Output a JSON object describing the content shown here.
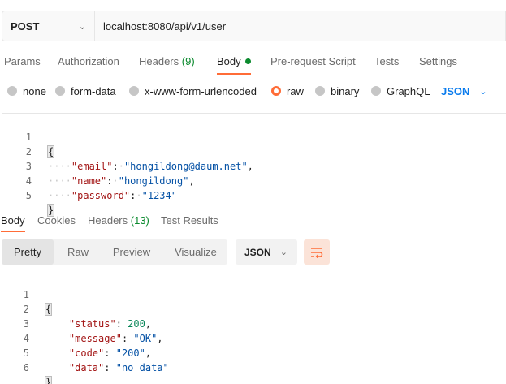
{
  "request": {
    "method": "POST",
    "url": "localhost:8080/api/v1/user"
  },
  "request_tabs": [
    {
      "label": "Params"
    },
    {
      "label": "Authorization"
    },
    {
      "label": "Headers",
      "count": "(9)"
    },
    {
      "label": "Body",
      "active": true
    },
    {
      "label": "Pre-request Script"
    },
    {
      "label": "Tests"
    },
    {
      "label": "Settings"
    }
  ],
  "body_types": [
    {
      "label": "none"
    },
    {
      "label": "form-data"
    },
    {
      "label": "x-www-form-urlencoded"
    },
    {
      "label": "raw",
      "selected": true
    },
    {
      "label": "binary"
    },
    {
      "label": "GraphQL"
    }
  ],
  "body_language": "JSON",
  "request_body": {
    "line_numbers": [
      "1",
      "2",
      "3",
      "4",
      "5"
    ],
    "open_brace": "{",
    "close_brace": "}",
    "fields": [
      {
        "key": "\"email\"",
        "value": "\"hongildong@daum.net\"",
        "suffix": ","
      },
      {
        "key": "\"name\"",
        "value": "\"hongildong\"",
        "suffix": ","
      },
      {
        "key": "\"password\"",
        "value": "\"1234\"",
        "suffix": ""
      }
    ]
  },
  "response_tabs": [
    {
      "label": "Body",
      "active": true
    },
    {
      "label": "Cookies"
    },
    {
      "label": "Headers",
      "count": "(13)"
    },
    {
      "label": "Test Results"
    }
  ],
  "view_modes": [
    {
      "label": "Pretty",
      "active": true
    },
    {
      "label": "Raw"
    },
    {
      "label": "Preview"
    },
    {
      "label": "Visualize"
    }
  ],
  "response_format": "JSON",
  "response_body": {
    "line_numbers": [
      "1",
      "2",
      "3",
      "4",
      "5",
      "6"
    ],
    "open_brace": "{",
    "close_brace": "}",
    "fields": [
      {
        "key": "\"status\"",
        "value": "200",
        "suffix": ","
      },
      {
        "key": "\"message\"",
        "value": "\"OK\"",
        "suffix": ","
      },
      {
        "key": "\"code\"",
        "value": "\"200\"",
        "suffix": ","
      },
      {
        "key": "\"data\"",
        "value": "\"no data\"",
        "suffix": ""
      }
    ]
  },
  "icons": {
    "method_dropdown": "chevron-down-icon",
    "language_dropdown": "chevron-down-icon",
    "format_dropdown": "chevron-down-icon",
    "wrap": "wrap-lines-icon"
  },
  "colors": {
    "accent": "#ff6c37",
    "success": "#0b8a2e",
    "link": "#097bed"
  }
}
